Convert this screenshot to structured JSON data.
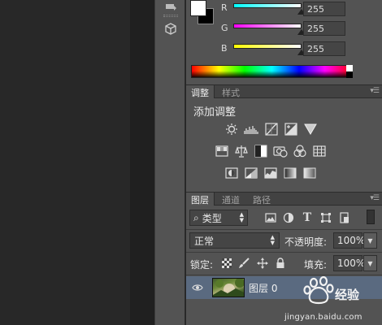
{
  "color_panel": {
    "channels": [
      {
        "label": "R",
        "value": "255",
        "gradient_start": "#00ffff",
        "gradient_end": "#ffffff"
      },
      {
        "label": "G",
        "value": "255",
        "gradient_start": "#ff00ff",
        "gradient_end": "#ffffff"
      },
      {
        "label": "B",
        "value": "255",
        "gradient_start": "#ffff00",
        "gradient_end": "#ffffff"
      }
    ],
    "foreground_color": "#ffffff",
    "background_color": "#000000"
  },
  "adjustments_panel": {
    "tabs": [
      "调整",
      "样式"
    ],
    "title": "添加调整",
    "icons": [
      [
        "brightness-contrast-icon",
        "levels-icon",
        "curves-icon",
        "exposure-icon",
        "vibrance-icon"
      ],
      [
        "hue-saturation-icon",
        "color-balance-icon",
        "black-white-icon",
        "photo-filter-icon",
        "channel-mixer-icon",
        "color-lookup-icon"
      ],
      [
        "invert-icon",
        "posterize-icon",
        "threshold-icon",
        "gradient-map-icon",
        "selective-color-icon"
      ]
    ]
  },
  "layers_panel": {
    "tabs": [
      "图层",
      "通道",
      "路径"
    ],
    "filter_kind": "类型",
    "blend_mode": "正常",
    "opacity_label": "不透明度:",
    "opacity_value": "100%",
    "lock_label": "锁定:",
    "fill_label": "填充:",
    "fill_value": "100%",
    "layers": [
      {
        "name": "图层 0",
        "visible": true,
        "selected": true
      }
    ]
  },
  "watermark": {
    "text": "jingyan.baidu.com"
  },
  "colors": {
    "panel_bg": "#535353",
    "selected_layer": "#5a6a80"
  }
}
